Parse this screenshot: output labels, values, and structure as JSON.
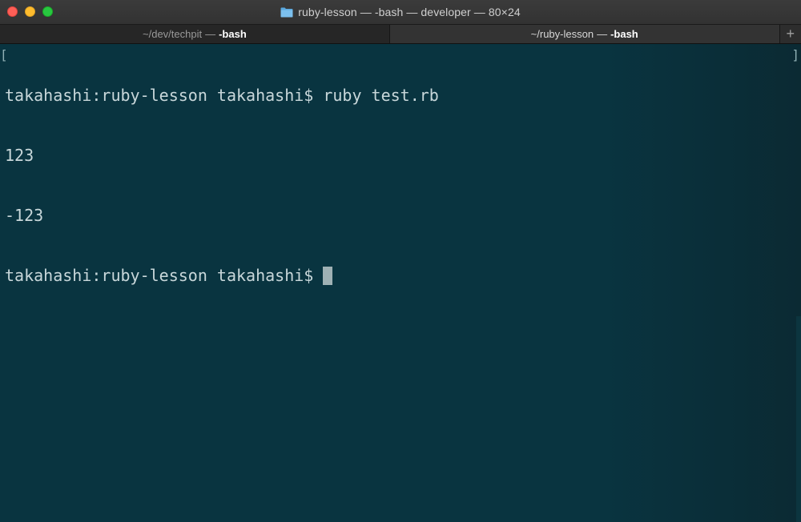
{
  "window": {
    "title": "ruby-lesson — -bash — developer — 80×24",
    "folder_icon": "folder-icon",
    "buttons": [
      "close-button",
      "minimize-button",
      "zoom-button"
    ]
  },
  "tabs": [
    {
      "path": "~/dev/techpit",
      "sep": "—",
      "proc": "-bash",
      "active": false
    },
    {
      "path": "~/ruby-lesson",
      "sep": "—",
      "proc": "-bash",
      "active": true
    }
  ],
  "new_tab_label": "+",
  "terminal": {
    "lines": [
      "takahashi:ruby-lesson takahashi$ ruby test.rb",
      "123",
      "-123",
      "takahashi:ruby-lesson takahashi$"
    ],
    "bracket_left": "[",
    "bracket_right": "]"
  },
  "colors": {
    "terminal_bg": "#093440",
    "terminal_fg": "#c8d7da",
    "close": "#fe5f57",
    "minimize": "#febc2e",
    "zoom": "#28c840"
  }
}
